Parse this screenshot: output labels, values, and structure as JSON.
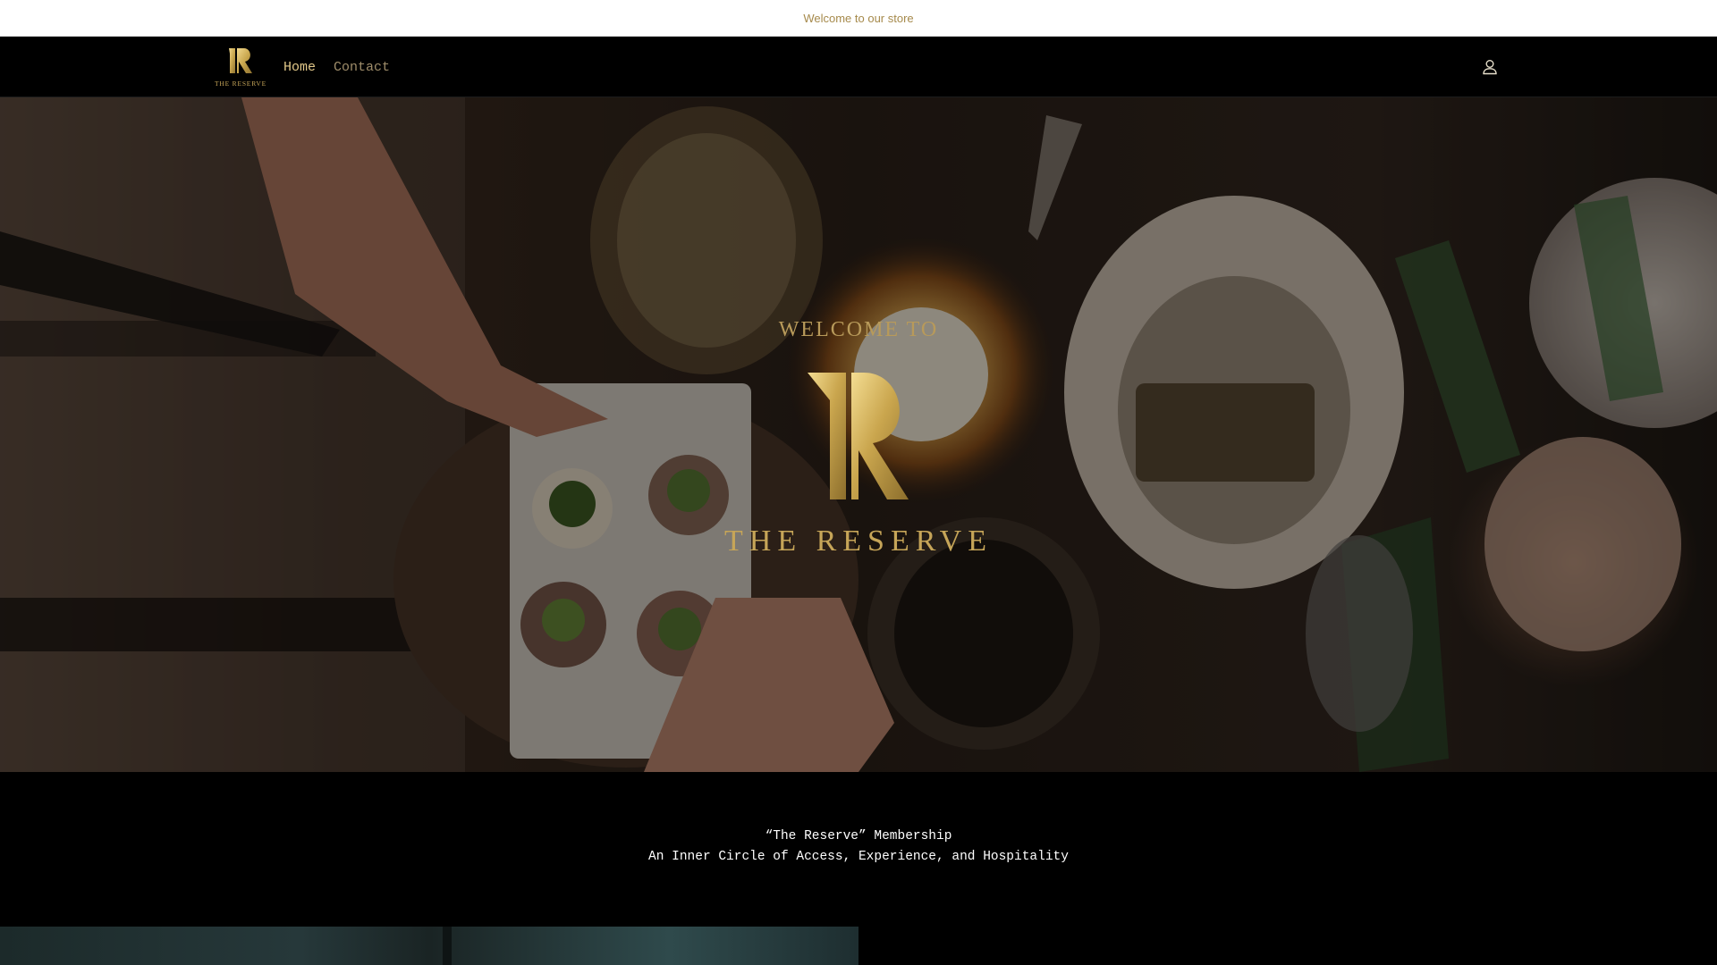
{
  "announcement": {
    "text": "Welcome to our store"
  },
  "header": {
    "logo_alt": "THE RESERVE",
    "nav": [
      {
        "label": "Home",
        "active": true
      },
      {
        "label": "Contact",
        "active": false
      }
    ],
    "account_icon": "account-icon"
  },
  "hero": {
    "welcome": "WELCOME TO",
    "brand": "THE RESERVE"
  },
  "membership": {
    "title": "“The Reserve” Membership",
    "subtitle": "An Inner Circle of Access, Experience, and Hospitality"
  },
  "colors": {
    "gold": "#c6a558",
    "gold_light": "#e3c98a",
    "background": "#000000",
    "announcement_text": "#a68a4c"
  }
}
